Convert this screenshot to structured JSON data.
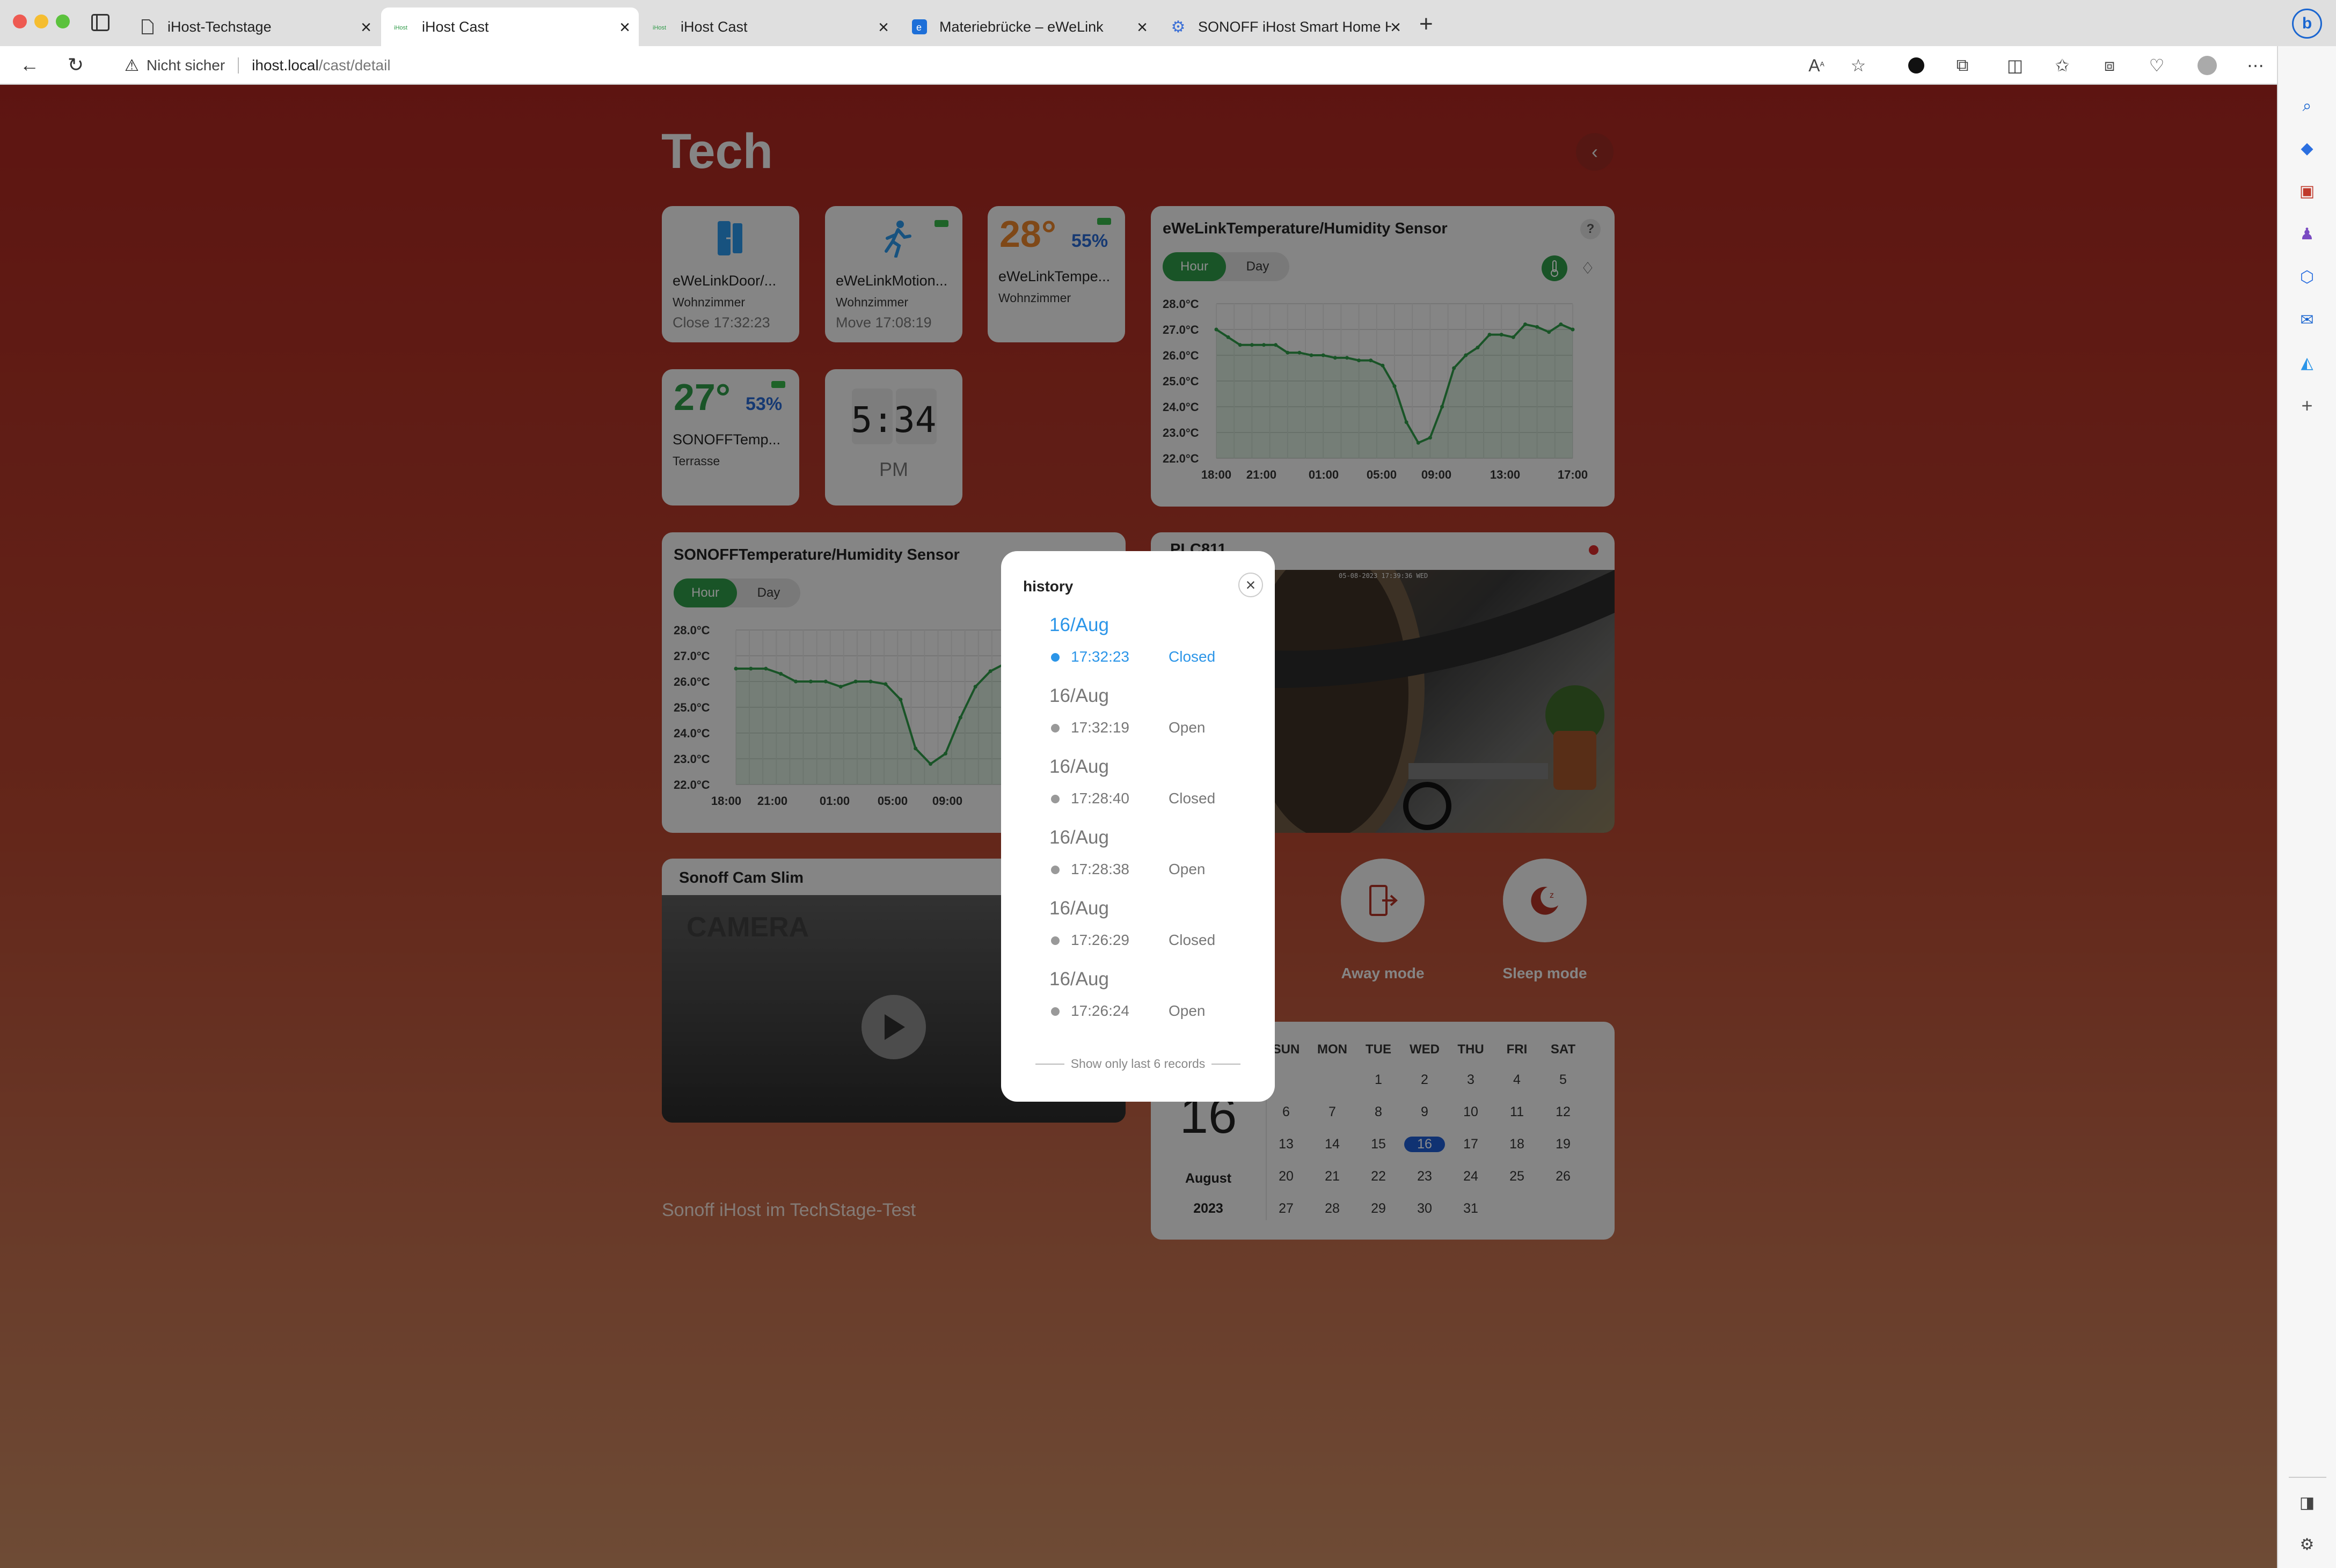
{
  "browser": {
    "tabs": [
      {
        "label": "iHost-Techstage"
      },
      {
        "label": "iHost Cast"
      },
      {
        "label": "iHost Cast"
      },
      {
        "label": "Materiebrücke – eWeLink"
      },
      {
        "label": "SONOFF iHost Smart Home Hu"
      }
    ],
    "security_label": "Nicht sicher",
    "url_host": "ihost.local",
    "url_path": "/cast/detail",
    "traffic_lights": [
      "#ee5a52",
      "#f5bd30",
      "#5bc23d"
    ]
  },
  "page": {
    "title": "Tech",
    "footer_text": "Sonoff iHost im TechStage-Test",
    "accent": "#2f9a48",
    "highlight": "#2b95e8"
  },
  "devices": [
    {
      "name": "eWeLinkDoor/...",
      "room": "Wohnzimmer",
      "status": "Close 17:32:23",
      "icon": "door-sensor-icon"
    },
    {
      "name": "eWeLinkMotion...",
      "room": "Wohnzimmer",
      "status": "Move 17:08:19",
      "icon": "motion-icon"
    },
    {
      "name": "eWeLinkTempe...",
      "room": "Wohnzimmer",
      "temp": "28°",
      "humidity": "55%"
    },
    {
      "name": "SONOFFTemp...",
      "room": "Terrasse",
      "temp": "27°",
      "humidity": "53%"
    }
  ],
  "clock": {
    "time": "5:34",
    "period": "PM"
  },
  "chart1_title": "eWeLinkTemperature/Humidity Sensor",
  "chart2_title": "SONOFFTemperature/Humidity Sensor",
  "segment": {
    "hour": "Hour",
    "day": "Day"
  },
  "help_symbol": "?",
  "chart_data": [
    {
      "type": "line",
      "title": "eWeLinkTemperature/Humidity Sensor",
      "x_ticks": [
        "18:00",
        "21:00",
        "01:00",
        "05:00",
        "09:00",
        "13:00",
        "17:00"
      ],
      "y_ticks": [
        "28.0°C",
        "27.0°C",
        "26.0°C",
        "25.0°C",
        "24.0°C",
        "23.0°C",
        "22.0°C"
      ],
      "ylim": [
        22,
        28
      ],
      "grid": true,
      "values": [
        27.0,
        26.7,
        26.4,
        26.4,
        26.4,
        26.4,
        26.1,
        26.1,
        26.0,
        26.0,
        25.9,
        25.9,
        25.8,
        25.8,
        25.6,
        24.8,
        23.4,
        22.6,
        22.8,
        24.0,
        25.5,
        26.0,
        26.3,
        26.8,
        26.8,
        26.7,
        27.2,
        27.1,
        26.9,
        27.2,
        27.0
      ]
    },
    {
      "type": "line",
      "title": "SONOFFTemperature/Humidity Sensor",
      "x_ticks": [
        "18:00",
        "21:00",
        "01:00",
        "05:00",
        "09:00"
      ],
      "y_ticks": [
        "28.0°C",
        "27.0°C",
        "26.0°C",
        "25.0°C",
        "24.0°C",
        "23.0°C",
        "22.0°C"
      ],
      "ylim": [
        22,
        28
      ],
      "grid": true,
      "values": [
        26.5,
        26.5,
        26.5,
        26.3,
        26.0,
        26.0,
        26.0,
        25.8,
        26.0,
        26.0,
        25.9,
        25.3,
        23.4,
        22.8,
        23.2,
        24.6,
        25.8,
        26.4,
        26.7
      ]
    }
  ],
  "cameras": [
    {
      "name": "PLC811",
      "timestamp": "05-08-2023 17:39:36 WED"
    },
    {
      "name": "Sonoff Cam Slim",
      "placeholder": "CAMERA"
    }
  ],
  "modes": [
    {
      "label": "Away mode",
      "icon": "away-mode-icon"
    },
    {
      "label": "Sleep mode",
      "icon": "sleep-mode-icon"
    }
  ],
  "calendar": {
    "day": "16",
    "month": "August",
    "year": "2023",
    "weekdays": [
      "SUN",
      "MON",
      "TUE",
      "WED",
      "THU",
      "FRI",
      "SAT"
    ],
    "weeks": [
      [
        "",
        "",
        "1",
        "2",
        "3",
        "4",
        "5"
      ],
      [
        "6",
        "7",
        "8",
        "9",
        "10",
        "11",
        "12"
      ],
      [
        "13",
        "14",
        "15",
        "16",
        "17",
        "18",
        "19"
      ],
      [
        "20",
        "21",
        "22",
        "23",
        "24",
        "25",
        "26"
      ],
      [
        "27",
        "28",
        "29",
        "30",
        "31",
        "",
        ""
      ]
    ],
    "today": "16"
  },
  "history": {
    "title": "history",
    "footer": "Show only last 6 records",
    "records": [
      {
        "date": "16/Aug",
        "time": "17:32:23",
        "state": "Closed",
        "latest": true
      },
      {
        "date": "16/Aug",
        "time": "17:32:19",
        "state": "Open"
      },
      {
        "date": "16/Aug",
        "time": "17:28:40",
        "state": "Closed"
      },
      {
        "date": "16/Aug",
        "time": "17:28:38",
        "state": "Open"
      },
      {
        "date": "16/Aug",
        "time": "17:26:29",
        "state": "Closed"
      },
      {
        "date": "16/Aug",
        "time": "17:26:24",
        "state": "Open"
      }
    ]
  }
}
